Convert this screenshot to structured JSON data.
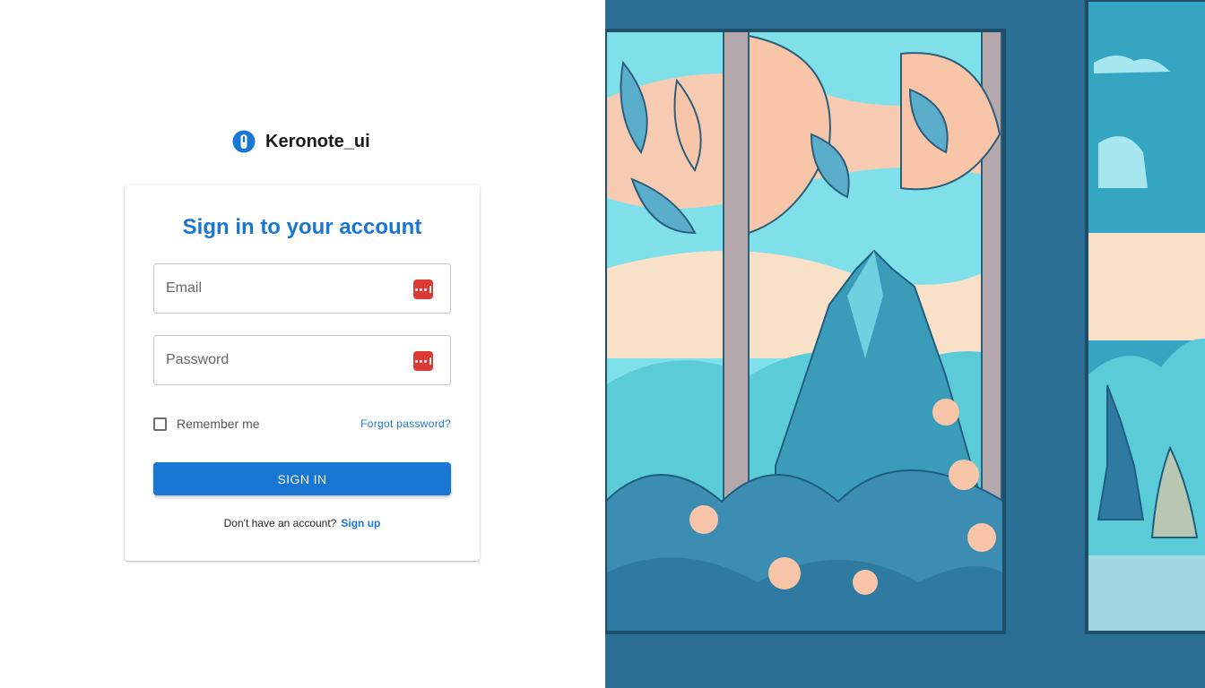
{
  "brand": {
    "name": "Keronote_ui",
    "icon": "logo-icon"
  },
  "login": {
    "title": "Sign in to your account",
    "email_placeholder": "Email",
    "password_placeholder": "Password",
    "field_icon": "password-manager-icon",
    "remember_label": "Remember me",
    "forgot_label": "Forgot password?",
    "submit_label": "SIGN IN",
    "no_account_text": "Don't have an account?",
    "signup_label": "Sign up"
  },
  "colors": {
    "primary": "#1976d2",
    "password_icon": "#d93a36",
    "illustration_frame": "#2a6e94"
  }
}
